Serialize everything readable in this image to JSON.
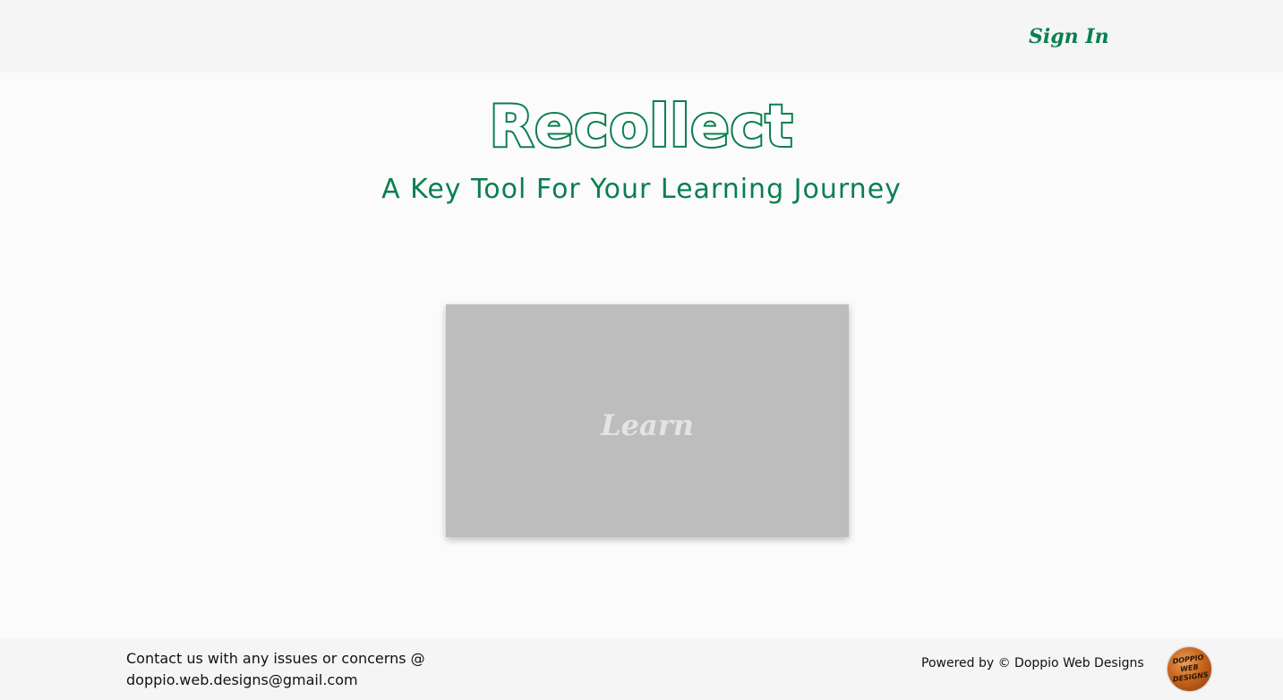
{
  "header": {
    "sign_in_label": "Sign In"
  },
  "hero": {
    "title": "Recollect",
    "subtitle": "A Key Tool For Your Learning Journey"
  },
  "cards": [
    {
      "label": "Learn"
    }
  ],
  "footer": {
    "contact_line1": "Contact us with any issues or concerns @",
    "contact_email": "doppio.web.designs@gmail.com",
    "powered_by": "Powered by © Doppio Web Designs",
    "logo_lines": [
      "DOPPIO",
      "WEB",
      "DESIGNS"
    ]
  },
  "colors": {
    "brand_green": "#0a7f50",
    "header_bg": "#f5f5f5",
    "card_bg": "#bdbdbd"
  }
}
